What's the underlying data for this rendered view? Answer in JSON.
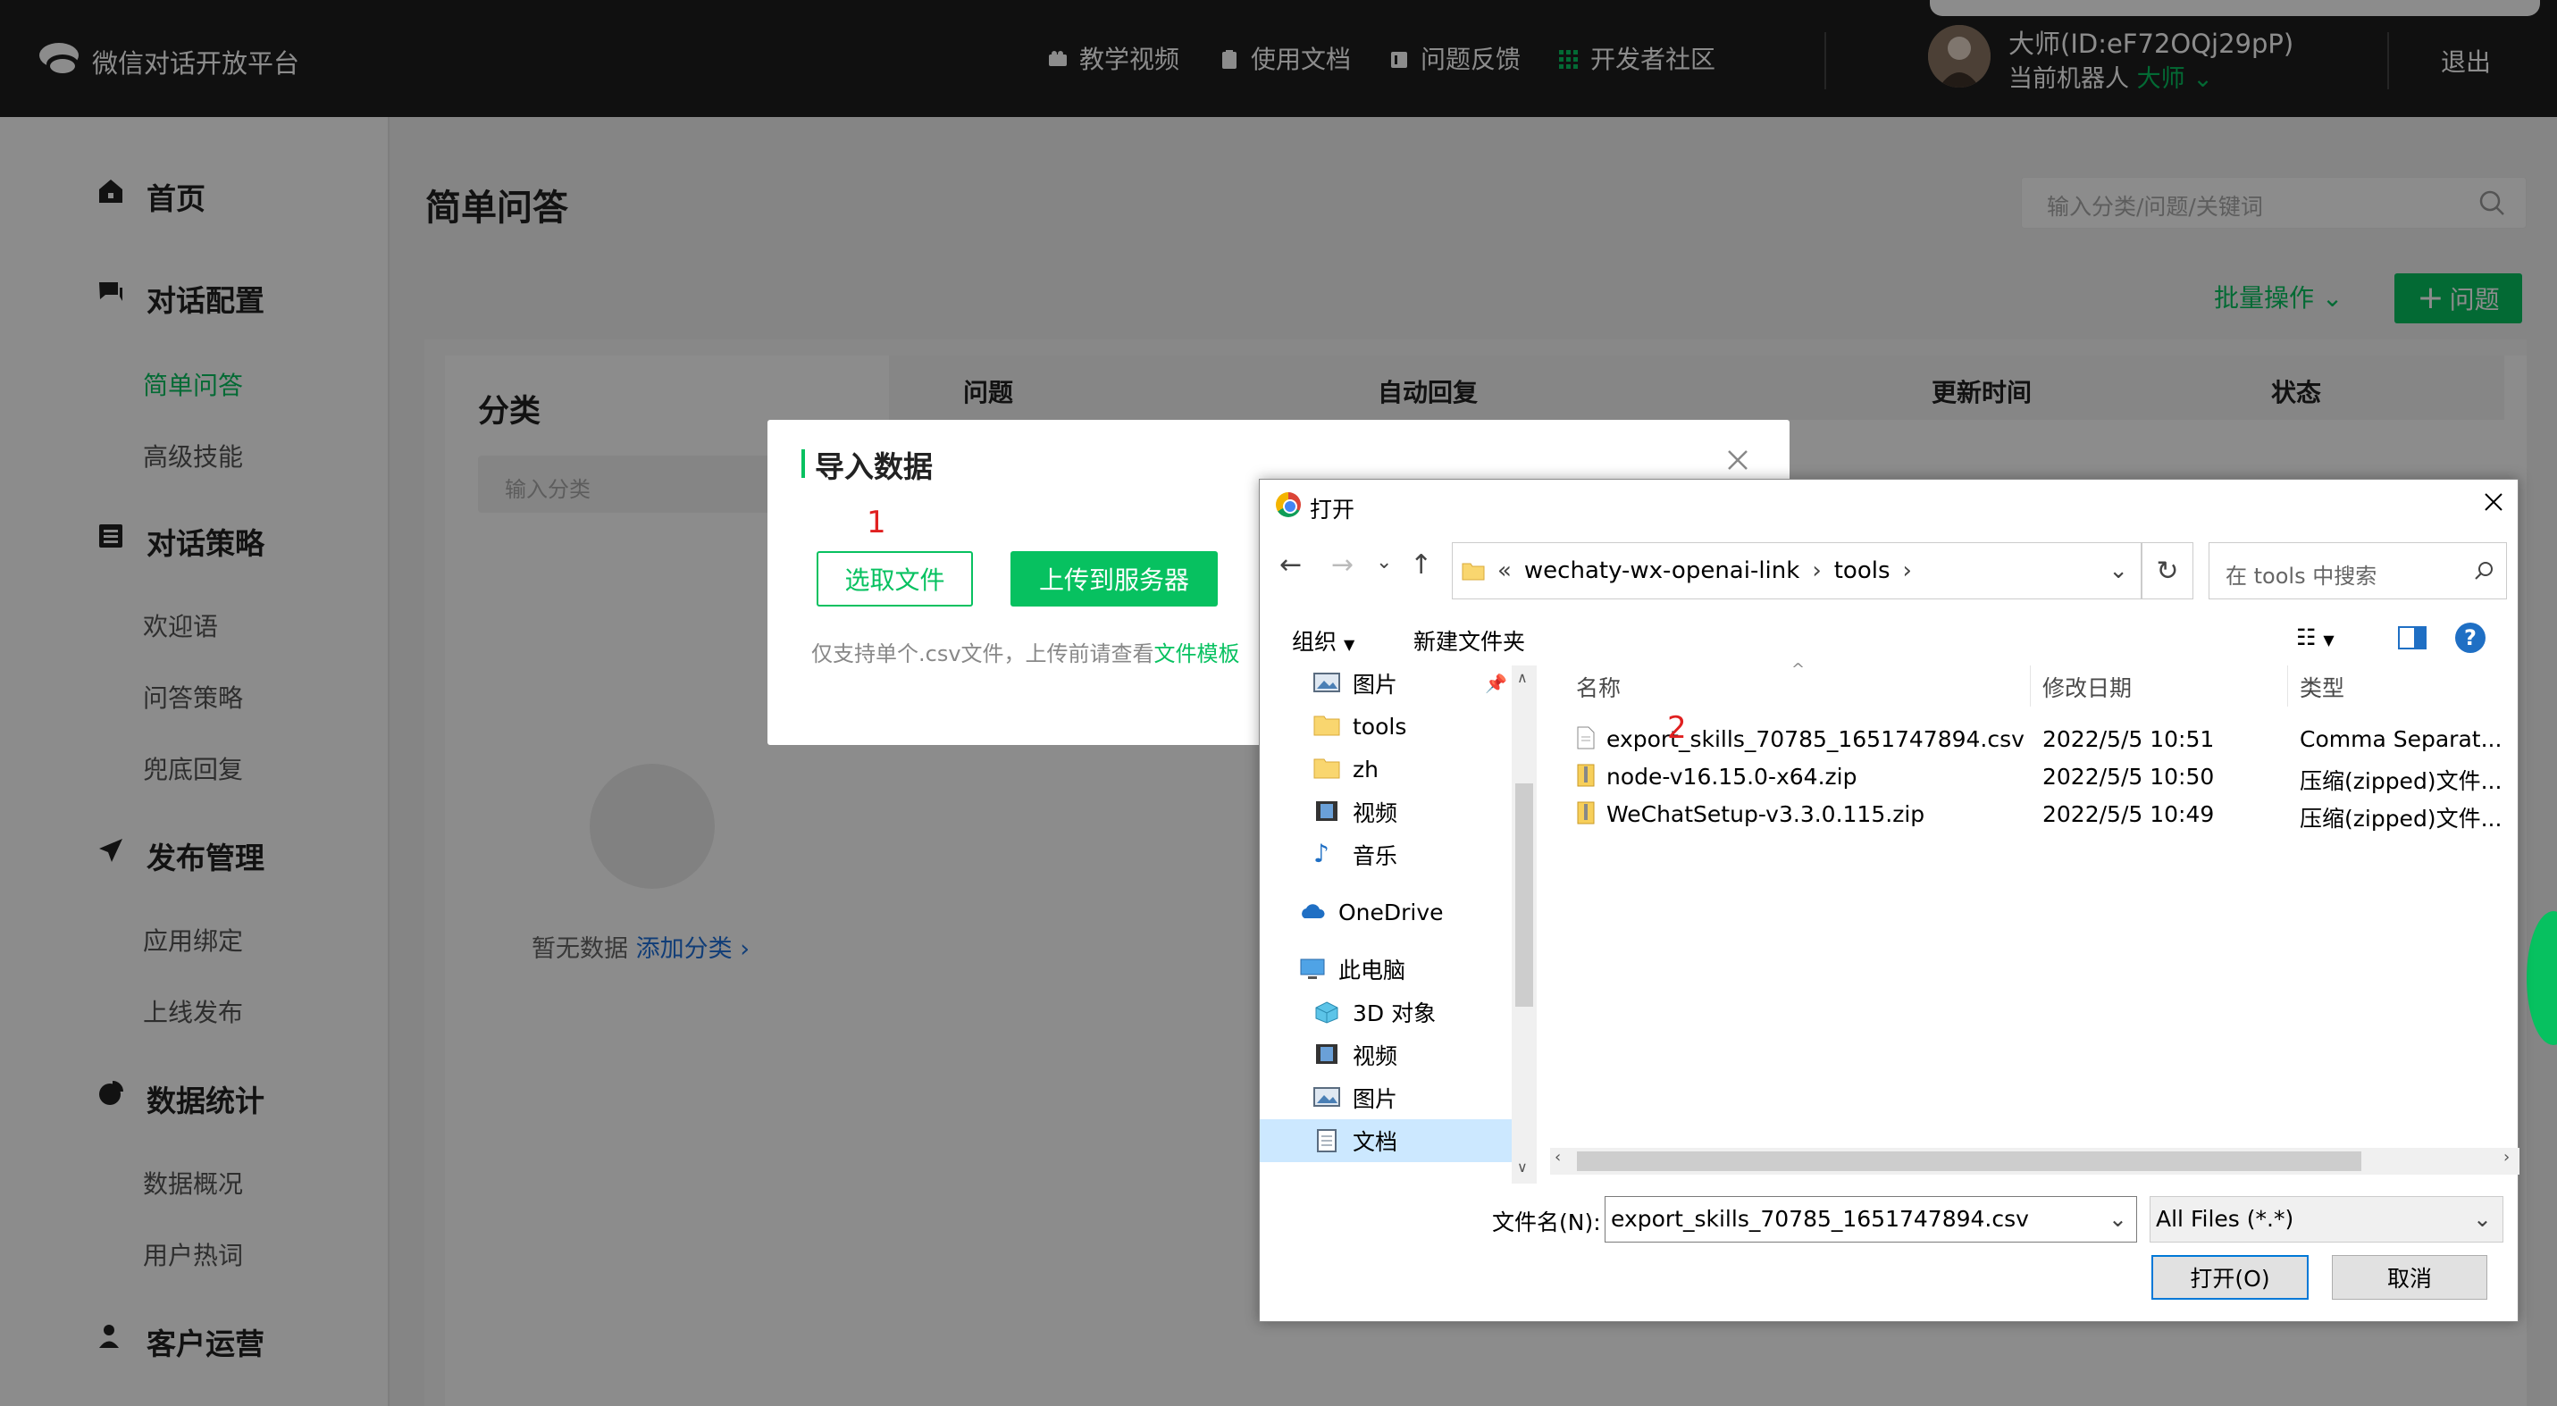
{
  "topbar": {
    "brand": "微信对话开放平台",
    "nav": [
      "教学视频",
      "使用文档",
      "问题反馈",
      "开发者社区"
    ],
    "user_name": "大师(ID:eF72OQj29pP)",
    "robot_label": "当前机器人",
    "robot_name": "大师",
    "logout": "退出"
  },
  "sidebar": {
    "home": "首页",
    "dialog_config": "对话配置",
    "simple_qa": "简单问答",
    "advanced_skill": "高级技能",
    "dialog_strategy": "对话策略",
    "welcome": "欢迎语",
    "qa_strategy": "问答策略",
    "fallback": "兜底回复",
    "publish_mgmt": "发布管理",
    "app_binding": "应用绑定",
    "go_live": "上线发布",
    "data_stats": "数据统计",
    "data_overview": "数据概况",
    "user_hot": "用户热词",
    "customer_ops": "客户运营"
  },
  "main": {
    "title": "简单问答",
    "search_placeholder": "输入分类/问题/关键词",
    "batch_ops": "批量操作",
    "add_question": "问题",
    "category_title": "分类",
    "category_placeholder": "输入分类",
    "empty_text": "暂无数据",
    "add_category": "添加分类",
    "columns": [
      "问题",
      "自动回复",
      "更新时间",
      "状态"
    ]
  },
  "import_dialog": {
    "title": "导入数据",
    "choose_file": "选取文件",
    "upload": "上传到服务器",
    "note": "仅支持单个.csv文件，上传前请查看",
    "template_link": "文件模板",
    "mark1": "1",
    "mark2": "2"
  },
  "file_dialog": {
    "title": "打开",
    "path_prefix": "«",
    "path": [
      "wechaty-wx-openai-link",
      "tools"
    ],
    "search_placeholder": "在 tools 中搜索",
    "organize": "组织",
    "new_folder": "新建文件夹",
    "tree": [
      "图片",
      "tools",
      "zh",
      "视频",
      "音乐",
      "OneDrive",
      "此电脑",
      "3D 对象",
      "视频",
      "图片",
      "文档"
    ],
    "columns": [
      "名称",
      "修改日期",
      "类型"
    ],
    "files": [
      {
        "name": "export_skills_70785_1651747894.csv",
        "date": "2022/5/5 10:51",
        "type": "Comma Separat..."
      },
      {
        "name": "node-v16.15.0-x64.zip",
        "date": "2022/5/5 10:50",
        "type": "压缩(zipped)文件..."
      },
      {
        "name": "WeChatSetup-v3.3.0.115.zip",
        "date": "2022/5/5 10:49",
        "type": "压缩(zipped)文件..."
      }
    ],
    "filename_label": "文件名(N):",
    "filename_value": "export_skills_70785_1651747894.csv",
    "filetype_value": "All Files (*.*)",
    "open_btn": "打开(O)",
    "cancel_btn": "取消"
  },
  "colors": {
    "accent": "#07c160",
    "link": "#1e6fd9",
    "mark": "#e02020",
    "topbar": "#1e1e1e"
  }
}
